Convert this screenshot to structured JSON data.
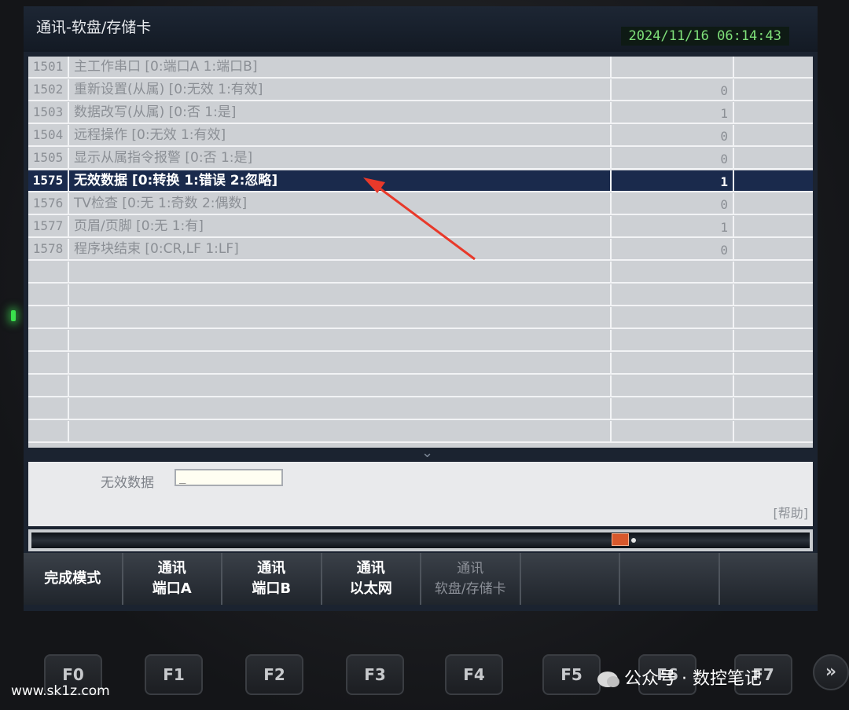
{
  "window": {
    "title": "通讯-软盘/存储卡",
    "datetime": "2024/11/16 06:14:43"
  },
  "params": [
    {
      "num": "1501",
      "desc": "主工作串口 [0:端口A  1:端口B]",
      "value": ""
    },
    {
      "num": "1502",
      "desc": "重新设置(从属) [0:无效  1:有效]",
      "value": "0"
    },
    {
      "num": "1503",
      "desc": "数据改写(从属) [0:否  1:是]",
      "value": "1"
    },
    {
      "num": "1504",
      "desc": "远程操作 [0:无效  1:有效]",
      "value": "0"
    },
    {
      "num": "1505",
      "desc": "显示从属指令报警 [0:否  1:是]",
      "value": "0"
    },
    {
      "num": "1575",
      "desc": "无效数据 [0:转换  1:错误  2:忽略]",
      "value": "1",
      "selected": true
    },
    {
      "num": "1576",
      "desc": "TV检查 [0:无  1:奇数  2:偶数]",
      "value": "0"
    },
    {
      "num": "1577",
      "desc": "页眉/页脚 [0:无  1:有]",
      "value": "1"
    },
    {
      "num": "1578",
      "desc": "程序块结束 [0:CR,LF  1:LF]",
      "value": "0"
    }
  ],
  "input": {
    "label": "无效数据",
    "value": "_",
    "help": "[帮助]"
  },
  "softkeys": [
    {
      "line1": "完成模式",
      "line2": ""
    },
    {
      "line1": "通讯",
      "line2": "端口A"
    },
    {
      "line1": "通讯",
      "line2": "端口B"
    },
    {
      "line1": "通讯",
      "line2": "以太网"
    },
    {
      "line1": "通讯",
      "line2": "软盘/存储卡",
      "active": true
    },
    {
      "line1": "",
      "line2": ""
    },
    {
      "line1": "",
      "line2": ""
    },
    {
      "line1": "",
      "line2": ""
    }
  ],
  "hardware_keys": [
    "F0",
    "F1",
    "F2",
    "F3",
    "F4",
    "F5",
    "F6",
    "F7"
  ],
  "more_key": "»",
  "watermarks": {
    "left": "www.sk1z.com",
    "right": "公众号 · 数控笔记"
  },
  "colors": {
    "selection": "#1a2a4c",
    "clock": "#7fe07a",
    "arrow": "#e8392a"
  }
}
